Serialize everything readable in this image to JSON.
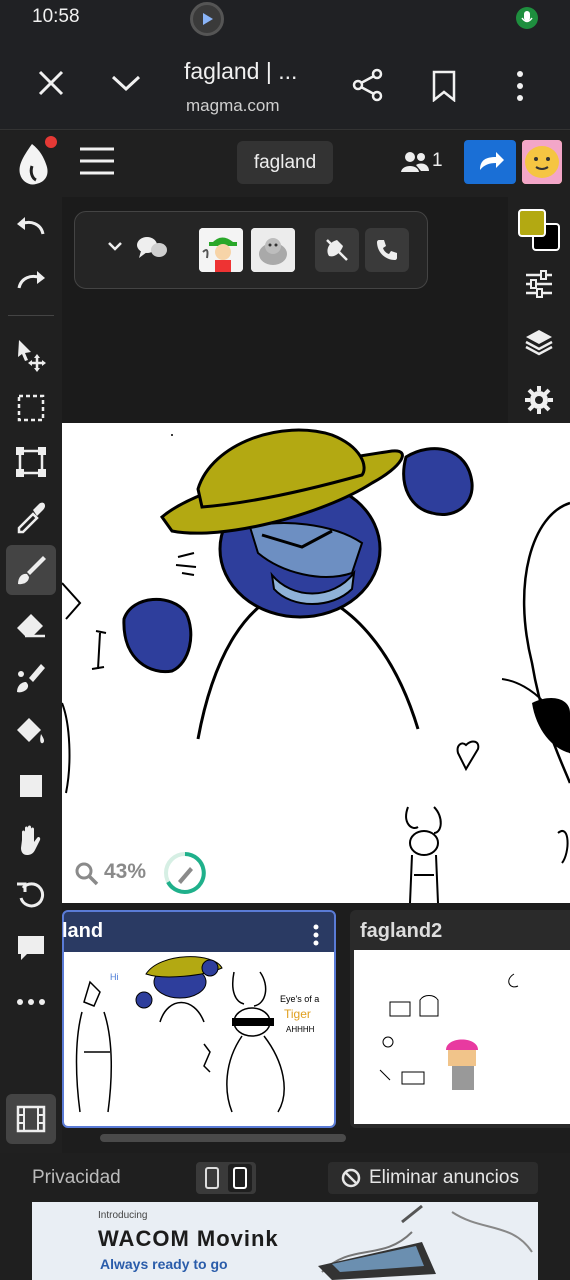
{
  "status_bar": {
    "time": "10:58"
  },
  "browser": {
    "title": "fagland | ...",
    "url": "magma.com"
  },
  "app": {
    "document_name": "fagland",
    "users_online": "1",
    "zoom": "43%",
    "accent_color": "#1a6fd6",
    "primary_color": "#b3a912",
    "secondary_color": "#000000"
  },
  "left_toolbar": {
    "tools": [
      "undo-icon",
      "redo-icon",
      "move-icon",
      "selection-icon",
      "transform-icon",
      "eyedropper-icon",
      "brush-icon",
      "eraser-icon",
      "smudge-icon",
      "fill-icon",
      "shape-icon",
      "hand-icon",
      "rotate-icon",
      "chat-icon",
      "more-icon",
      "film-icon"
    ],
    "active_tool": "brush-icon"
  },
  "right_panel": {
    "tools": [
      "color-swatch",
      "sliders-icon",
      "layers-icon",
      "gear-icon"
    ]
  },
  "float_panel": {
    "items": [
      "chevron-down-icon",
      "chat-bubbles-icon",
      "participant-avatar-1",
      "participant-avatar-2",
      "mute-icon",
      "phone-icon"
    ]
  },
  "thumbnails": [
    {
      "title": "fagland",
      "visible_title": "land",
      "active": true
    },
    {
      "title": "fagland2",
      "visible_title": "fagland2",
      "active": false
    }
  ],
  "thumb_text": {
    "hi": "Hi",
    "eye_of_tiger_1": "Eye's of a",
    "eye_of_tiger_2": "Tiger",
    "eye_of_tiger_3": "AHHHH"
  },
  "ad_bar": {
    "privacy": "Privacidad",
    "remove_ads": "Eliminar anuncios",
    "banner": {
      "intro": "Introducing",
      "brand": "WACOM Movink",
      "tagline": "Always ready to go"
    }
  }
}
